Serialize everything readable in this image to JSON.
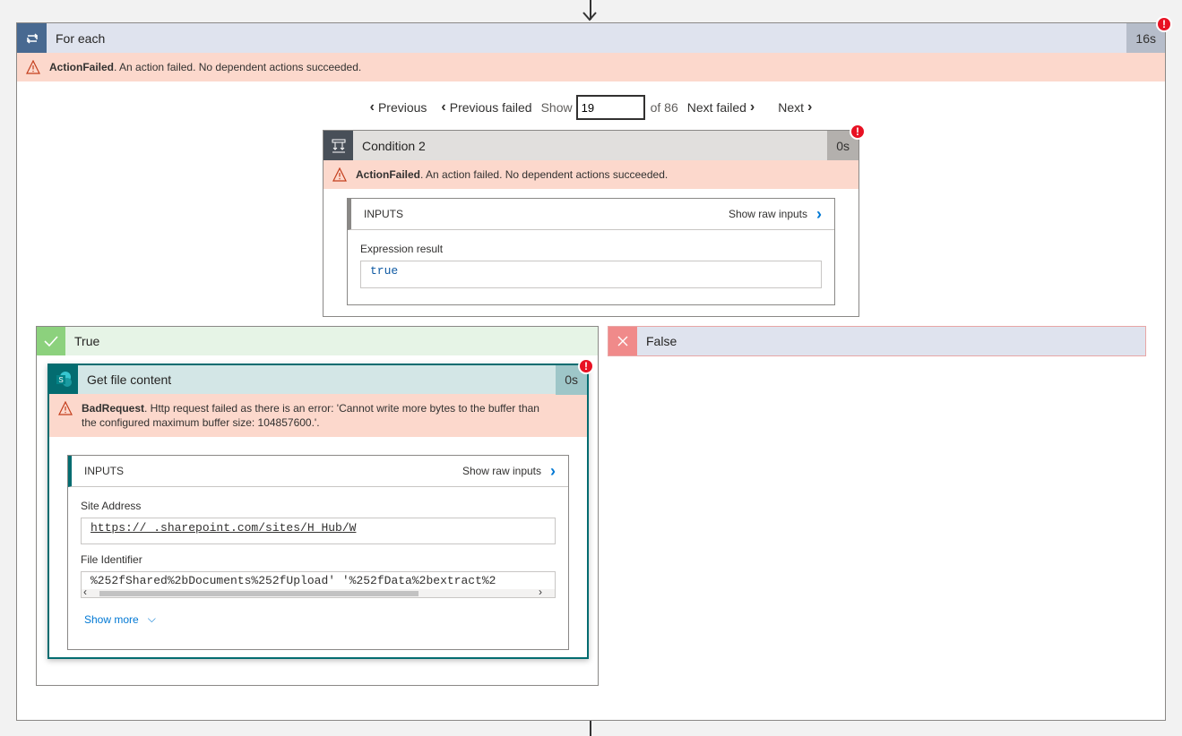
{
  "foreach": {
    "title": "For each",
    "duration": "16s",
    "error_code": "ActionFailed",
    "error_message": ". An action failed. No dependent actions succeeded."
  },
  "pager": {
    "previous": "Previous",
    "previous_failed": "Previous failed",
    "show": "Show",
    "current": "19",
    "of_total": "of 86",
    "next_failed": "Next failed",
    "next": "Next"
  },
  "condition": {
    "title": "Condition 2",
    "duration": "0s",
    "error_code": "ActionFailed",
    "error_message": ". An action failed. No dependent actions succeeded.",
    "inputs_label": "INPUTS",
    "show_raw": "Show raw inputs",
    "field_label": "Expression result",
    "field_value": "true"
  },
  "branch_true": {
    "label": "True"
  },
  "branch_false": {
    "label": "False"
  },
  "get_file": {
    "title": "Get file content",
    "duration": "0s",
    "error_code": "BadRequest",
    "error_message": ". Http request failed as there is an error: 'Cannot write more bytes to the buffer than the configured maximum buffer size: 104857600.'.",
    "inputs_label": "INPUTS",
    "show_raw": "Show raw inputs",
    "site_label": "Site Address",
    "site_value": "https://        .sharepoint.com/sites/H        Hub/W",
    "file_label": "File Identifier",
    "file_value": "%252fShared%2bDocuments%252fUpload'             '%252fData%2bextract%2",
    "show_more": "Show more"
  },
  "colors": {
    "error_banner": "#fcd8cc",
    "foreach_accent": "#486991",
    "sharepoint_accent": "#036c70",
    "true_accent": "#8cd17d",
    "false_accent": "#f08a8a"
  }
}
